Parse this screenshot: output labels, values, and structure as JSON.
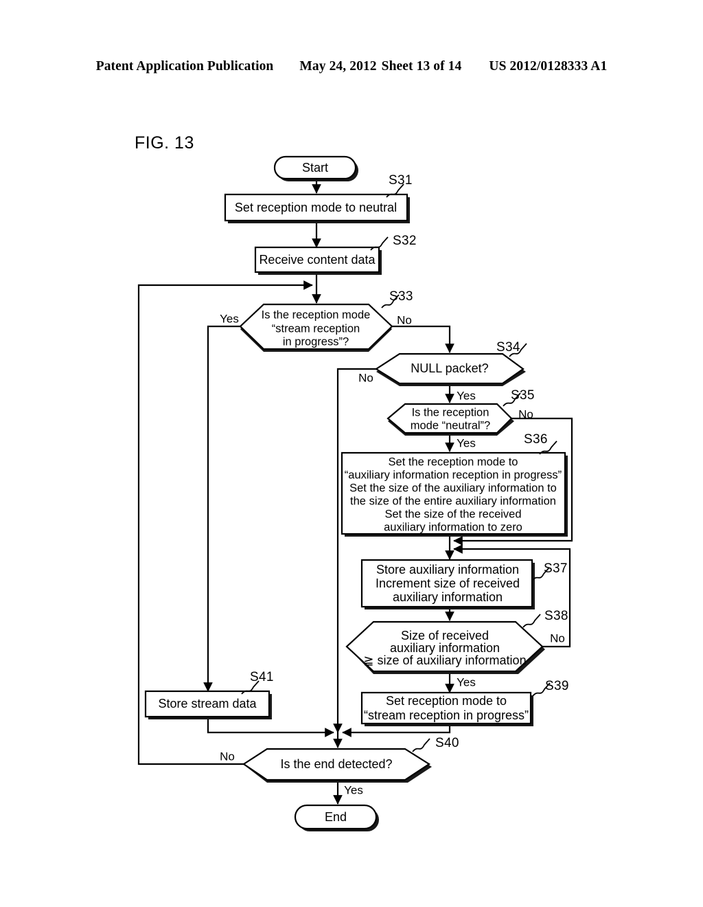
{
  "header": {
    "publication": "Patent Application Publication",
    "date": "May 24, 2012",
    "sheet": "Sheet 13 of 14",
    "number": "US 2012/0128333 A1"
  },
  "figure": {
    "label": "FIG. 13"
  },
  "chart_data": {
    "type": "diagram",
    "title": "FIG. 13",
    "diagram_kind": "flowchart",
    "nodes": [
      {
        "id": "start",
        "step": "",
        "shape": "terminal",
        "text": [
          "Start"
        ]
      },
      {
        "id": "s31",
        "step": "S31",
        "shape": "process",
        "text": [
          "Set reception mode to neutral"
        ]
      },
      {
        "id": "s32",
        "step": "S32",
        "shape": "process",
        "text": [
          "Receive content data"
        ]
      },
      {
        "id": "s33",
        "step": "S33",
        "shape": "decision",
        "text": [
          "Is the reception mode",
          "“stream reception",
          "in progress”?"
        ]
      },
      {
        "id": "s34",
        "step": "S34",
        "shape": "decision",
        "text": [
          "NULL packet?"
        ]
      },
      {
        "id": "s35",
        "step": "S35",
        "shape": "decision",
        "text": [
          "Is the reception",
          "mode “neutral”?"
        ]
      },
      {
        "id": "s36",
        "step": "S36",
        "shape": "process",
        "text": [
          "Set the reception mode to",
          "“auxiliary information reception in progress”",
          "Set the size of the auxiliary information to",
          "the size of the entire auxiliary information",
          "Set the size of the received",
          "auxiliary information to zero"
        ]
      },
      {
        "id": "s37",
        "step": "S37",
        "shape": "process",
        "text": [
          "Store auxiliary information",
          "Increment size of received",
          "auxiliary information"
        ]
      },
      {
        "id": "s38",
        "step": "S38",
        "shape": "decision",
        "text": [
          "Size of received",
          "auxiliary information",
          "≧ size of auxiliary information"
        ]
      },
      {
        "id": "s39",
        "step": "S39",
        "shape": "process",
        "text": [
          "Set reception mode to",
          "“stream reception in progress”"
        ]
      },
      {
        "id": "s40",
        "step": "S40",
        "shape": "decision",
        "text": [
          "Is the end detected?"
        ]
      },
      {
        "id": "s41",
        "step": "S41",
        "shape": "process",
        "text": [
          "Store stream data"
        ]
      },
      {
        "id": "end",
        "step": "",
        "shape": "terminal",
        "text": [
          "End"
        ]
      }
    ],
    "edges": [
      {
        "from": "start",
        "to": "s31",
        "label": ""
      },
      {
        "from": "s31",
        "to": "s32",
        "label": ""
      },
      {
        "from": "s32",
        "to": "s33",
        "label": ""
      },
      {
        "from": "s33",
        "to": "s41",
        "label": "Yes"
      },
      {
        "from": "s33",
        "to": "s34",
        "label": "No"
      },
      {
        "from": "s34",
        "to": "s40",
        "label": "No"
      },
      {
        "from": "s34",
        "to": "s35",
        "label": "Yes"
      },
      {
        "from": "s35",
        "to": "s37",
        "label": "No"
      },
      {
        "from": "s35",
        "to": "s36",
        "label": "Yes"
      },
      {
        "from": "s36",
        "to": "s37",
        "label": ""
      },
      {
        "from": "s37",
        "to": "s38",
        "label": ""
      },
      {
        "from": "s38",
        "to": "s37",
        "label": "No"
      },
      {
        "from": "s38",
        "to": "s39",
        "label": "Yes"
      },
      {
        "from": "s39",
        "to": "s40",
        "label": ""
      },
      {
        "from": "s41",
        "to": "s40",
        "label": ""
      },
      {
        "from": "s40",
        "to": "s32",
        "label": "No"
      },
      {
        "from": "s40",
        "to": "end",
        "label": "Yes"
      }
    ],
    "branch_labels": {
      "s33_yes": "Yes",
      "s33_no": "No",
      "s34_no": "No",
      "s34_yes": "Yes",
      "s35_no": "No",
      "s35_yes": "Yes",
      "s38_no": "No",
      "s38_yes": "Yes",
      "s40_no": "No",
      "s40_yes": "Yes"
    },
    "step_ids": {
      "s31": "S31",
      "s32": "S32",
      "s33": "S33",
      "s34": "S34",
      "s35": "S35",
      "s36": "S36",
      "s37": "S37",
      "s38": "S38",
      "s39": "S39",
      "s40": "S40",
      "s41": "S41"
    },
    "node_text": {
      "start": "Start",
      "end": "End",
      "s31_l1": "Set reception mode to neutral",
      "s32_l1": "Receive content data",
      "s33_l1": "Is the reception mode",
      "s33_l2": "“stream reception",
      "s33_l3": "in progress”?",
      "s34_l1": "NULL packet?",
      "s35_l1": "Is the reception",
      "s35_l2": "mode “neutral”?",
      "s36_l1": "Set the reception mode to",
      "s36_l2": "“auxiliary information reception in progress”",
      "s36_l3": "Set the size of the auxiliary information to",
      "s36_l4": "the size of the entire auxiliary information",
      "s36_l5": "Set the size of the received",
      "s36_l6": "auxiliary information to zero",
      "s37_l1": "Store auxiliary information",
      "s37_l2": "Increment size of received",
      "s37_l3": "auxiliary information",
      "s38_l1": "Size of received",
      "s38_l2": "auxiliary information",
      "s38_l3": "≧ size of auxiliary information",
      "s39_l1": "Set reception mode to",
      "s39_l2": "“stream reception in progress”",
      "s40_l1": "Is the end detected?",
      "s41_l1": "Store stream data"
    },
    "colors": {
      "ink": "#000000",
      "paper": "#ffffff"
    }
  }
}
